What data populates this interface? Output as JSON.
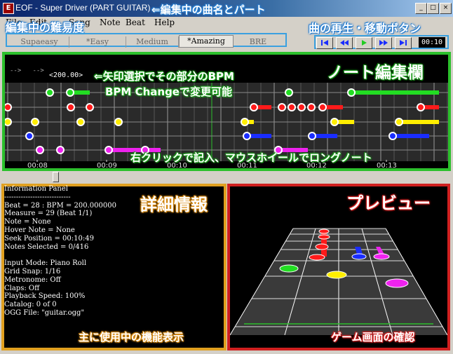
{
  "window": {
    "title": "EOF - Super Driver (PART GUITAR)",
    "icon": "eof-app-icon",
    "controls": [
      "_",
      "□",
      "×"
    ]
  },
  "menu": {
    "items": [
      "File",
      "Edit",
      "Song",
      "Note",
      "Beat",
      "Help"
    ]
  },
  "difficulty_tabs": [
    "Supaeasy",
    "*Easy",
    "Medium",
    "*Amazing",
    "BRE"
  ],
  "selected_difficulty": "*Amazing",
  "transport": {
    "buttons": [
      "rewind-start",
      "rewind",
      "play",
      "fast-forward",
      "forward-end"
    ],
    "time": "00:10"
  },
  "piano_roll": {
    "bpm_marker": "<200.00>",
    "time_labels": [
      "00:08",
      "00:09",
      "00:10",
      "00:11",
      "00:12",
      "00:13"
    ],
    "lanes": [
      "green",
      "red",
      "yellow",
      "blue",
      "purple"
    ],
    "colors": {
      "green": "#22dd22",
      "red": "#ff1a1a",
      "yellow": "#ffee00",
      "blue": "#1a2dff",
      "purple": "#ee22ee",
      "frame": "#2cc02c"
    }
  },
  "info_panel": {
    "lines": [
      "Information Panel",
      "----------------------------",
      "Beat = 28 : BPM = 200.000000",
      "Measure = 29 (Beat 1/1)",
      "Note = None",
      "Hover Note = None",
      "Seek Position = 00:10:49",
      "Notes Selected = 0/416",
      "",
      "Input Mode: Piano Roll",
      "Grid Snap: 1/16",
      "Metronome: Off",
      "Claps: Off",
      "Playback Speed: 100%",
      "Catalog: 0 of 0",
      "OGG File: \"guitar.ogg\""
    ]
  },
  "annotations": {
    "title_note": "⇐編集中の曲名とパート",
    "difficulty_note": "編集中の難易度",
    "transport_note": "曲の再生・移動ボタン",
    "bpm_note_1": "⇐矢印選択でその部分のBPM",
    "bpm_note_2": "BPM Changeで変更可能",
    "roll_note": "ノート編集欄",
    "click_note": "右クリックで記入、マウスホイールでロングノート",
    "details_note": "詳細情報",
    "details_footer": "主に使用中の機能表示",
    "preview_note": "プレビュー",
    "preview_footer": "ゲーム画面の確認"
  }
}
